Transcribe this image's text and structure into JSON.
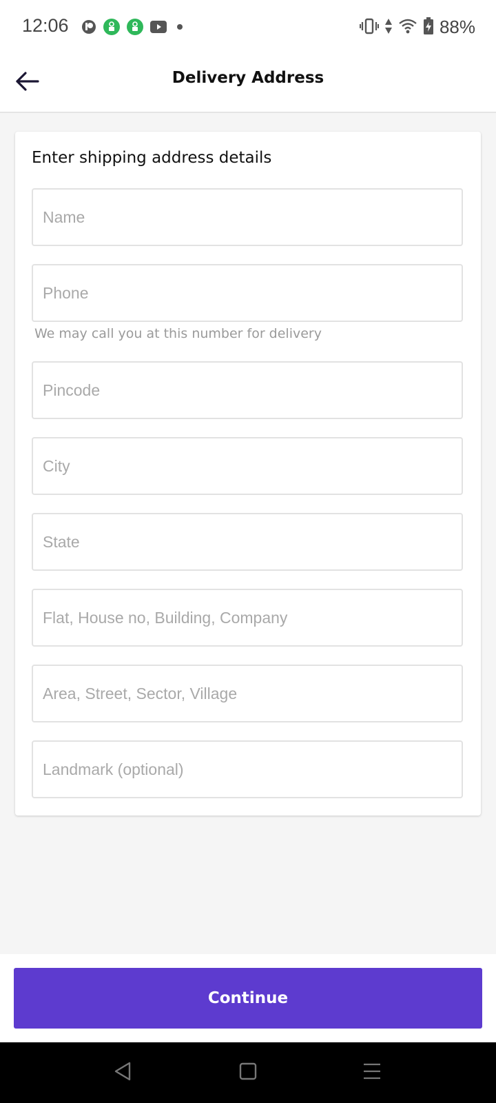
{
  "status_bar": {
    "time": "12:06",
    "battery": "88%",
    "icons_left": [
      "face-circle-icon",
      "app-green-icon",
      "app-green-icon",
      "youtube-icon",
      "dot-icon"
    ],
    "icons_right": [
      "vibrate-icon",
      "data-arrows-icon",
      "wifi-icon",
      "battery-charging-icon"
    ]
  },
  "app_bar": {
    "title": "Delivery Address",
    "back_icon": "arrow-left-icon"
  },
  "form": {
    "heading": "Enter shipping address details",
    "fields": {
      "name": {
        "placeholder": "Name",
        "value": ""
      },
      "phone": {
        "placeholder": "Phone",
        "value": ""
      },
      "pincode": {
        "placeholder": "Pincode",
        "value": ""
      },
      "city": {
        "placeholder": "City",
        "value": ""
      },
      "state": {
        "placeholder": "State",
        "value": ""
      },
      "flat": {
        "placeholder": "Flat, House no, Building, Company",
        "value": ""
      },
      "area": {
        "placeholder": "Area, Street, Sector, Village",
        "value": ""
      },
      "landmark": {
        "placeholder": "Landmark (optional)",
        "value": ""
      }
    },
    "phone_helper": "We may call you at this number for delivery"
  },
  "footer": {
    "continue_label": "Continue"
  },
  "colors": {
    "accent": "#5d3bcf",
    "background": "#f5f5f5",
    "field_border": "#e2e2e2",
    "placeholder": "#a9a9a9",
    "status_green": "#2fb85a"
  }
}
